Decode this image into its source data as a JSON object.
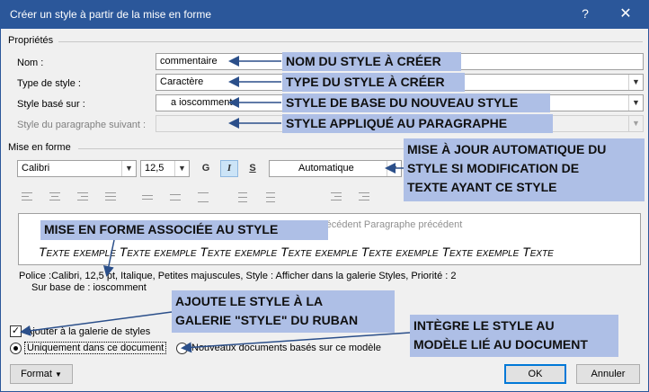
{
  "window": {
    "title": "Créer un style à partir de la mise en forme",
    "help_glyph": "?",
    "close_glyph": "✕"
  },
  "properties": {
    "section": "Propriétés",
    "name_label": "Nom :",
    "name_value": "commentaire",
    "type_label": "Type de style :",
    "type_value": "Caractère",
    "based_label": "Style basé sur :",
    "based_value": "a ioscomment",
    "next_label": "Style du paragraphe suivant :",
    "next_value": ""
  },
  "formatting": {
    "section": "Mise en forme",
    "font": "Calibri",
    "size": "12,5",
    "bold": "G",
    "italic": "I",
    "underline": "S",
    "color": "Automatique"
  },
  "preview": {
    "previous_text": "récédent Paragraphe précédent",
    "sample_text": "Texte exemple Texte exemple Texte exemple Texte exemple Texte exemple Texte exemple Texte"
  },
  "description": {
    "line1": "Police :Calibri, 12,5 pt, Italique, Petites majuscules, Style : Afficher dans la galerie Styles, Priorité : 2",
    "line2": "Sur base de : ioscomment"
  },
  "options": {
    "add_gallery": "Ajouter à la galerie de styles",
    "only_document": "Uniquement dans ce document",
    "new_documents": "Nouveaux documents basés sur ce modèle"
  },
  "buttons": {
    "format": "Format",
    "ok": "OK",
    "cancel": "Annuler"
  },
  "annotations": {
    "name": "NOM DU STYLE À CRÉER",
    "type": "TYPE DU STYLE À CRÉER",
    "based": "STYLE DE BASE DU NOUVEAU STYLE",
    "next": "STYLE APPLIQUÉ AU PARAGRAPHE",
    "auto_update": [
      "MISE À JOUR AUTOMATIQUE DU",
      "STYLE SI MODIFICATION DE",
      "TEXTE AYANT CE STYLE"
    ],
    "format_assoc": "MISE EN FORME ASSOCIÉE AU STYLE",
    "gallery": [
      "AJOUTE LE STYLE À LA",
      "GALERIE \"STYLE\" DU RUBAN"
    ],
    "template": [
      "INTÈGRE LE STYLE AU",
      "MODÈLE LIÉ AU DOCUMENT"
    ]
  },
  "colors": {
    "titlebar": "#2b579a",
    "annotation_bg": "#aebfe6",
    "arrow": "#2b4f8a",
    "default_button": "#0078d7"
  }
}
